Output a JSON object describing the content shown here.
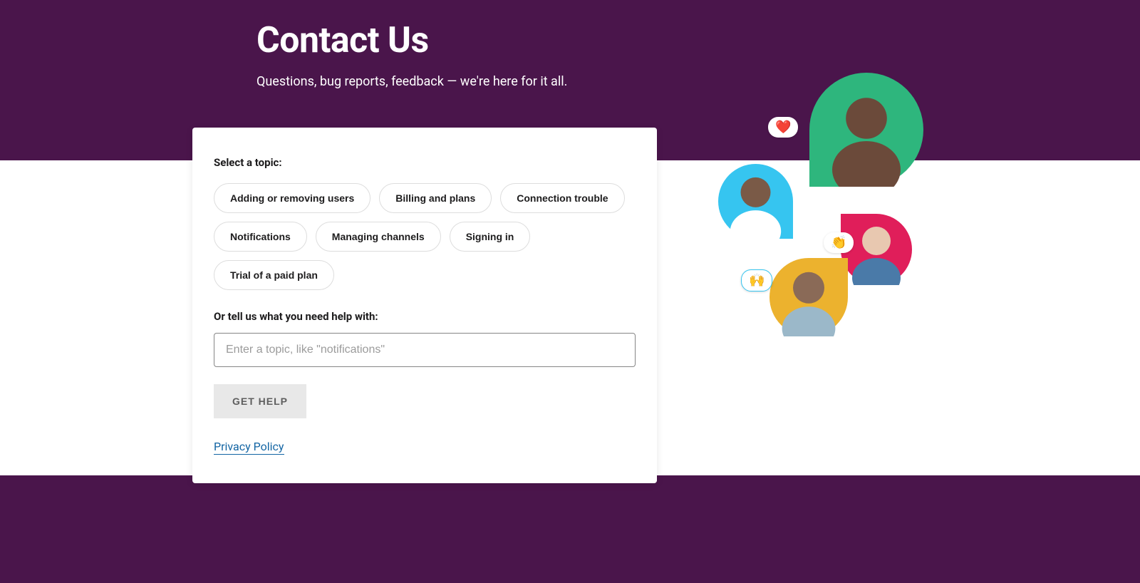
{
  "header": {
    "title": "Contact Us",
    "subtitle": "Questions, bug reports, feedback — we're here for it all."
  },
  "form": {
    "select_label": "Select a topic:",
    "topics": [
      "Adding or removing users",
      "Billing and plans",
      "Connection trouble",
      "Notifications",
      "Managing channels",
      "Signing in",
      "Trial of a paid plan"
    ],
    "tell_label": "Or tell us what you need help with:",
    "input_placeholder": "Enter a topic, like \"notifications\"",
    "submit_label": "GET HELP",
    "privacy_link": "Privacy Policy"
  },
  "decor": {
    "emoji_heart": "❤️",
    "emoji_clap": "👏",
    "emoji_raise": "🙌"
  }
}
